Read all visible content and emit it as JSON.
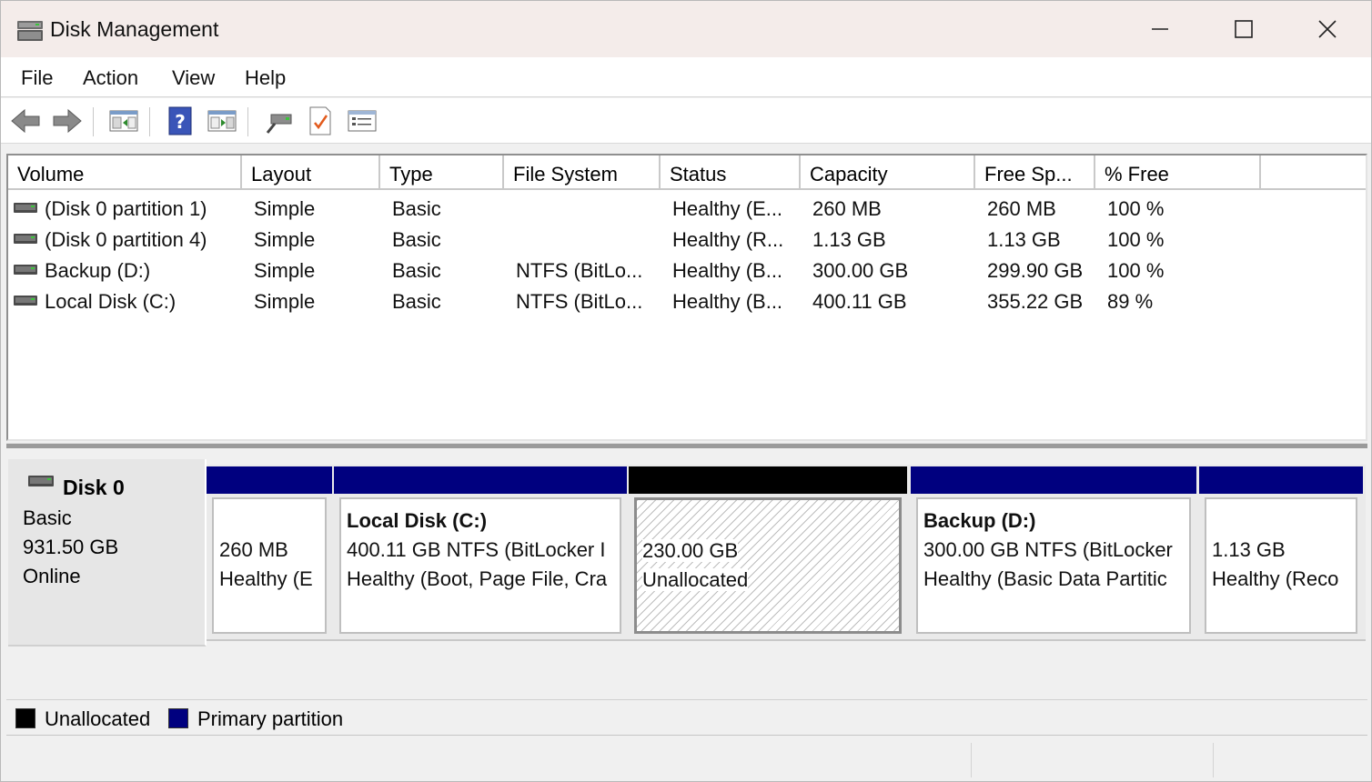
{
  "window": {
    "title": "Disk Management"
  },
  "menu": [
    "File",
    "Action",
    "View",
    "Help"
  ],
  "toolbar": [
    "back-arrow-icon",
    "forward-arrow-icon",
    "console-tree-icon",
    "help-icon",
    "action-pane-icon",
    "connect-icon",
    "check-icon",
    "properties-list-icon"
  ],
  "volume_list": {
    "columns": [
      "Volume",
      "Layout",
      "Type",
      "File System",
      "Status",
      "Capacity",
      "Free Sp...",
      "% Free"
    ],
    "rows": [
      {
        "volume": "(Disk 0 partition 1)",
        "layout": "Simple",
        "type": "Basic",
        "fs": "",
        "status": "Healthy (E...",
        "capacity": "260 MB",
        "free": "260 MB",
        "pct": "100 %"
      },
      {
        "volume": "(Disk 0 partition 4)",
        "layout": "Simple",
        "type": "Basic",
        "fs": "",
        "status": "Healthy (R...",
        "capacity": "1.13 GB",
        "free": "1.13 GB",
        "pct": "100 %"
      },
      {
        "volume": "Backup (D:)",
        "layout": "Simple",
        "type": "Basic",
        "fs": "NTFS (BitLo...",
        "status": "Healthy (B...",
        "capacity": "300.00 GB",
        "free": "299.90 GB",
        "pct": "100 %"
      },
      {
        "volume": "Local Disk (C:)",
        "layout": "Simple",
        "type": "Basic",
        "fs": "NTFS (BitLo...",
        "status": "Healthy (B...",
        "capacity": "400.11 GB",
        "free": "355.22 GB",
        "pct": "89 %"
      }
    ]
  },
  "disk": {
    "name": "Disk 0",
    "type": "Basic",
    "size": "931.50 GB",
    "state": "Online",
    "partitions": [
      {
        "title": "",
        "line1": "260 MB",
        "line2": "Healthy (E",
        "kind": "primary"
      },
      {
        "title": "Local Disk  (C:)",
        "line1": "400.11 GB NTFS (BitLocker I",
        "line2": "Healthy (Boot, Page File, Cra",
        "kind": "primary"
      },
      {
        "title": "",
        "line1": "230.00 GB",
        "line2": "Unallocated",
        "kind": "unallocated"
      },
      {
        "title": "Backup  (D:)",
        "line1": "300.00 GB NTFS (BitLocker",
        "line2": "Healthy (Basic Data Partitic",
        "kind": "primary"
      },
      {
        "title": "",
        "line1": "1.13 GB",
        "line2": "Healthy (Reco",
        "kind": "primary"
      }
    ]
  },
  "legend": [
    {
      "label": "Unallocated",
      "color": "#000000"
    },
    {
      "label": "Primary partition",
      "color": "#00007f"
    }
  ],
  "colors": {
    "primary": "#00007f",
    "unallocated": "#000000"
  }
}
